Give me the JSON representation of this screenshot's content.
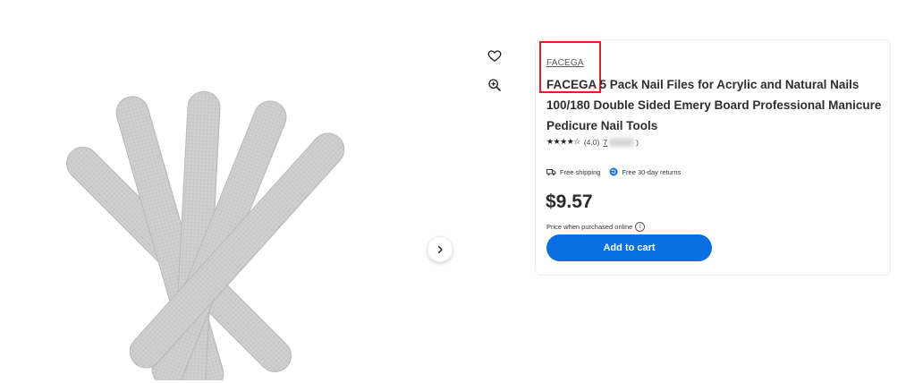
{
  "product": {
    "brand": "FACEGA",
    "title": "FACEGA 5 Pack Nail Files for Acrylic and Natural Nails 100/180 Double Sided Emery Board Professional Manicure Pedicure Nail Tools",
    "stars": "★★★★☆",
    "rating_text": "(4.0)",
    "review_count_prefix": "7",
    "rating_close": ")",
    "free_shipping": "Free shipping",
    "free_returns": "Free 30-day returns",
    "price": "$9.57",
    "price_note": "Price when purchased online",
    "add_to_cart": "Add to cart"
  },
  "icons": {
    "favorite": "heart-icon",
    "zoom": "zoom-in-icon",
    "next": "chevron-right-icon",
    "shipping": "truck-icon",
    "returns": "return-icon",
    "info": "info-icon"
  },
  "colors": {
    "accent": "#0a6fe0",
    "highlight": "#e02020",
    "nail_file": "#cfcfcf"
  }
}
